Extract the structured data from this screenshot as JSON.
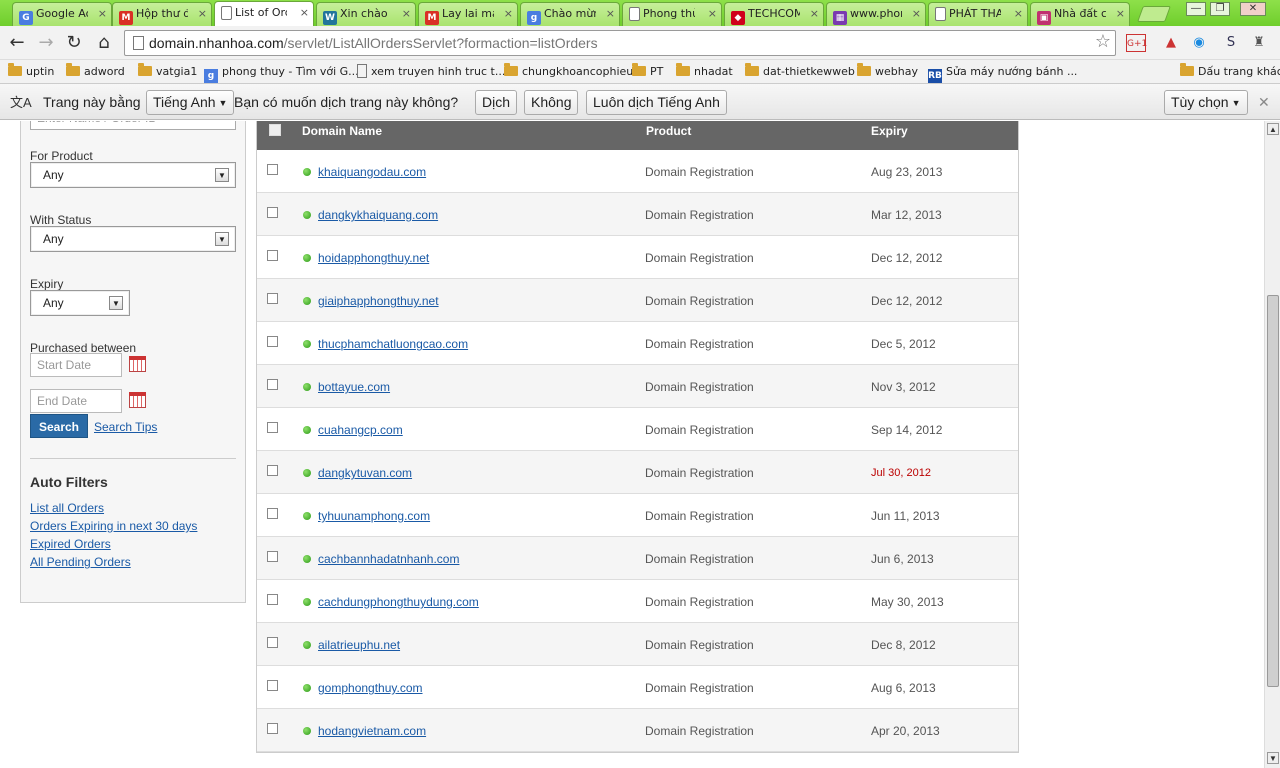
{
  "tabs": [
    {
      "title": "Google Adw",
      "icon": "google-icon",
      "color": "#4a7de0",
      "glyph": "G"
    },
    {
      "title": "Hộp thư đế",
      "icon": "gmail-icon",
      "color": "#d93025",
      "glyph": "M"
    },
    {
      "title": "List of Orde",
      "icon": "page-icon",
      "color": "#ffffff",
      "glyph": "",
      "active": true
    },
    {
      "title": "Xin chào Pl",
      "icon": "wordpress-icon",
      "color": "#21759b",
      "glyph": "W"
    },
    {
      "title": "Lay lai mat",
      "icon": "gmail-icon",
      "color": "#d93025",
      "glyph": "M"
    },
    {
      "title": "Chào mừng",
      "icon": "google-icon",
      "color": "#4a7de0",
      "glyph": "g"
    },
    {
      "title": "Phong thủy",
      "icon": "page-icon",
      "color": "#ffffff",
      "glyph": ""
    },
    {
      "title": "TECHCOME",
      "icon": "techcombank-icon",
      "color": "#d0021b",
      "glyph": "◆"
    },
    {
      "title": "www.phon",
      "icon": "site-icon",
      "color": "#7a3ab0",
      "glyph": "▦"
    },
    {
      "title": "PHÁT THAN",
      "icon": "page-icon",
      "color": "#ffffff",
      "glyph": ""
    },
    {
      "title": "Nhà đất ch",
      "icon": "site-icon",
      "color": "#c03070",
      "glyph": "▣"
    }
  ],
  "close_glyph": "×",
  "window": {
    "minimize": "—",
    "maximize": "❐",
    "close": "✕"
  },
  "toolbar": {
    "back": "←",
    "forward": "→",
    "reload": "↻",
    "home": "⌂",
    "url_host": "domain.nhanhoa.com",
    "url_rest": "/servlet/ListAllOrdersServlet?formaction=listOrders",
    "star": "☆",
    "extensions": [
      "G+1",
      "▲",
      "◉",
      "S",
      "♜",
      "🔧"
    ]
  },
  "bookmarks": [
    {
      "label": "uptin",
      "type": "folder"
    },
    {
      "label": "adword",
      "type": "folder"
    },
    {
      "label": "vatgia1",
      "type": "folder"
    },
    {
      "label": "phong thuy - Tìm với G...",
      "type": "link",
      "icon_color": "#4a7de0",
      "glyph": "g"
    },
    {
      "label": "xem truyen hinh truc t...",
      "type": "page"
    },
    {
      "label": "chungkhoancophieu",
      "type": "folder"
    },
    {
      "label": "PT",
      "type": "folder"
    },
    {
      "label": "nhadat",
      "type": "folder"
    },
    {
      "label": "dat-thietkewweb",
      "type": "folder"
    },
    {
      "label": "webhay",
      "type": "folder"
    },
    {
      "label": "Sửa máy nướng bánh ...",
      "type": "link",
      "icon_color": "#1a4ea8",
      "glyph": "RB"
    },
    {
      "label": "Dấu trang khác",
      "type": "folder"
    }
  ],
  "translate": {
    "prefix": "Trang này bằng",
    "language": "Tiếng Anh",
    "question": "Bạn có muốn dịch trang này không?",
    "translate_btn": "Dịch",
    "no_btn": "Không",
    "always_btn": "Luôn dịch Tiếng Anh",
    "options_btn": "Tùy chọn",
    "close": "✕"
  },
  "filters": {
    "name_placeholder": "Enter Name / Order ID",
    "product_label": "For Product",
    "product_value": "Any",
    "status_label": "With Status",
    "status_value": "Any",
    "expiry_label": "Expiry",
    "expiry_value": "Any",
    "purchased_label": "Purchased between",
    "start_placeholder": "Start Date",
    "end_placeholder": "End Date",
    "search_btn": "Search",
    "search_tips": "Search Tips",
    "auto_heading": "Auto Filters",
    "auto_links": [
      "List all Orders",
      "Orders Expiring in next 30 days",
      "Expired Orders",
      "All Pending Orders"
    ]
  },
  "table": {
    "headers": {
      "domain": "Domain Name",
      "product": "Product",
      "expiry": "Expiry"
    },
    "rows": [
      {
        "domain": "khaiquangodau.com",
        "product": "Domain Registration",
        "expiry": "Aug 23, 2013"
      },
      {
        "domain": "dangkykhaiquang.com",
        "product": "Domain Registration",
        "expiry": "Mar 12, 2013"
      },
      {
        "domain": "hoidapphongthuy.net",
        "product": "Domain Registration",
        "expiry": "Dec 12, 2012"
      },
      {
        "domain": "giaiphapphongthuy.net",
        "product": "Domain Registration",
        "expiry": "Dec 12, 2012"
      },
      {
        "domain": "thucphamchatluongcao.com",
        "product": "Domain Registration",
        "expiry": "Dec 5, 2012"
      },
      {
        "domain": "bottayue.com",
        "product": "Domain Registration",
        "expiry": "Nov 3, 2012"
      },
      {
        "domain": "cuahangcp.com",
        "product": "Domain Registration",
        "expiry": "Sep 14, 2012"
      },
      {
        "domain": "dangkytuvan.com",
        "product": "Domain Registration",
        "expiry": "Jul 30, 2012",
        "expired": true
      },
      {
        "domain": "tyhuunamphong.com",
        "product": "Domain Registration",
        "expiry": "Jun 11, 2013"
      },
      {
        "domain": "cachbannhadatnhanh.com",
        "product": "Domain Registration",
        "expiry": "Jun 6, 2013"
      },
      {
        "domain": "cachdungphongthuydung.com",
        "product": "Domain Registration",
        "expiry": "May 30, 2013"
      },
      {
        "domain": "ailatrieuphu.net",
        "product": "Domain Registration",
        "expiry": "Dec 8, 2012"
      },
      {
        "domain": "gomphongthuy.com",
        "product": "Domain Registration",
        "expiry": "Aug 6, 2013"
      },
      {
        "domain": "hodangvietnam.com",
        "product": "Domain Registration",
        "expiry": "Apr 20, 2013"
      }
    ]
  },
  "scrollbar": {
    "up": "▲",
    "down": "▼"
  }
}
